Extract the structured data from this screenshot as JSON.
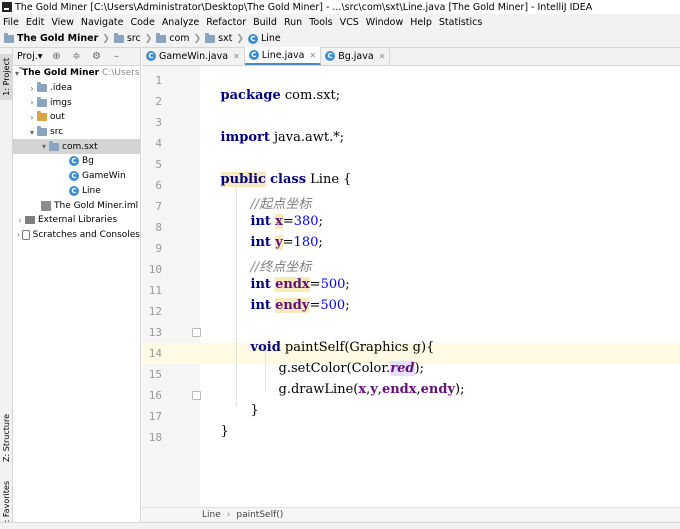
{
  "window": {
    "title": "The Gold Miner [C:\\Users\\Administrator\\Desktop\\The Gold Miner] - ...\\src\\com\\sxt\\Line.java [The Gold Miner] - IntelliJ IDEA"
  },
  "menu": [
    "File",
    "Edit",
    "View",
    "Navigate",
    "Code",
    "Analyze",
    "Refactor",
    "Build",
    "Run",
    "Tools",
    "VCS",
    "Window",
    "Help",
    "Statistics"
  ],
  "breadcrumbs": {
    "project": "The Gold Miner",
    "src": "src",
    "com": "com",
    "sxt": "sxt",
    "file": "Line"
  },
  "side_tabs": {
    "project": "1: Project",
    "structure": "Z: Structure",
    "favorites": "2: Favorites"
  },
  "project_panel": {
    "title": "Proj.▾",
    "tree": {
      "root": "The Gold Miner",
      "root_path": "C:\\Users\\A",
      "idea": ".idea",
      "imgs": "imgs",
      "out": "out",
      "src": "src",
      "package": "com.sxt",
      "class_bg": "Bg",
      "class_gamewin": "GameWin",
      "class_line": "Line",
      "iml": "The Gold Miner.iml",
      "external_libraries": "External Libraries",
      "scratches": "Scratches and Consoles"
    }
  },
  "editor_tabs": [
    "GameWin.java",
    "Line.java",
    "Bg.java"
  ],
  "code": {
    "line_numbers": [
      "1",
      "2",
      "3",
      "4",
      "5",
      "6",
      "7",
      "8",
      "9",
      "10",
      "11",
      "12",
      "13",
      "14",
      "15",
      "16",
      "17",
      "18"
    ],
    "l1": {
      "kw": "package",
      "rest": " com.sxt;"
    },
    "l3": {
      "kw": "import",
      "rest": " java.awt.*;"
    },
    "l5": {
      "kw1": "public",
      "kw2": "class",
      "rest": " Line {"
    },
    "l6": "//起点坐标",
    "l7": {
      "kw": "int",
      "var": "x",
      "eq": "=",
      "num": "380",
      "end": ";"
    },
    "l8": {
      "kw": "int",
      "var": "y",
      "eq": "=",
      "num": "180",
      "end": ";"
    },
    "l9": "//终点坐标",
    "l10": {
      "kw": "int",
      "var": "endx",
      "eq": "=",
      "num": "500",
      "end": ";"
    },
    "l11": {
      "kw": "int",
      "var": "endy",
      "eq": "=",
      "num": "500",
      "end": ";"
    },
    "l13": {
      "kw": "void",
      "rest": " paintSelf(Graphics g){"
    },
    "l14": {
      "pre": "g.setColor(Color.",
      "fld": "red",
      "post": ");"
    },
    "l15": {
      "pre": "g.drawLine(",
      "a": "x",
      "c1": ",",
      "b": "y",
      "c2": ",",
      "c": "endx",
      "c3": ",",
      "d": "endy",
      "post": ");"
    },
    "l16": "}",
    "l17": "}"
  },
  "footer_breadcrumb": {
    "class": "Line",
    "method": "paintSelf()"
  }
}
